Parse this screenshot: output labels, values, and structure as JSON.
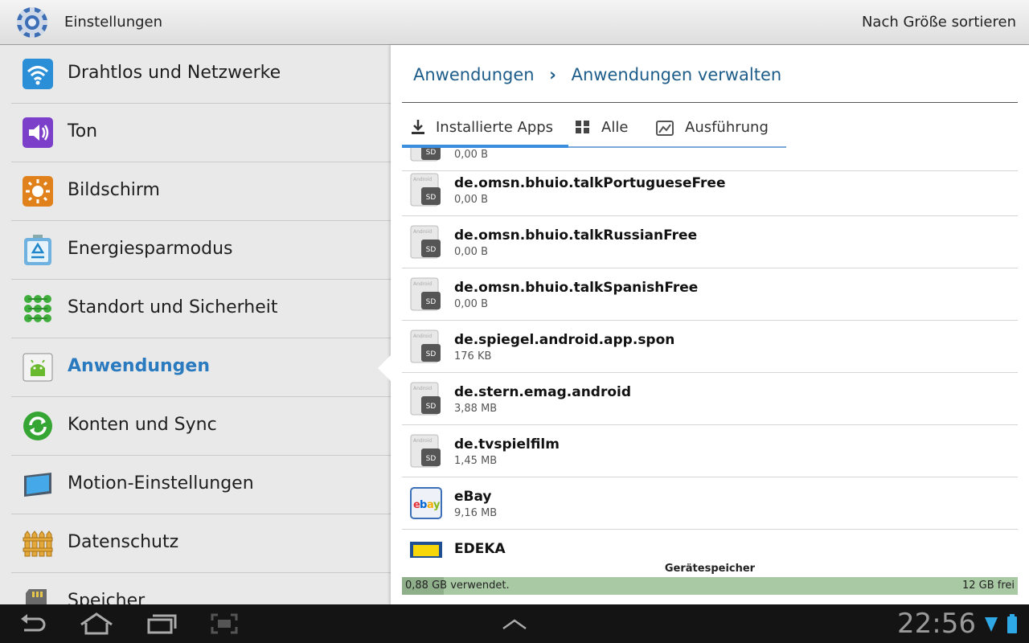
{
  "actionbar": {
    "title": "Einstellungen",
    "sort_label": "Nach Größe sortieren"
  },
  "sidebar": {
    "items": [
      {
        "label": "Drahtlos und Netzwerke",
        "icon": "wifi-icon"
      },
      {
        "label": "Ton",
        "icon": "speaker-icon"
      },
      {
        "label": "Bildschirm",
        "icon": "brightness-icon"
      },
      {
        "label": "Energiesparmodus",
        "icon": "recycle-icon"
      },
      {
        "label": "Standort und Sicherheit",
        "icon": "location-grid-icon"
      },
      {
        "label": "Anwendungen",
        "icon": "android-icon",
        "active": true
      },
      {
        "label": "Konten und Sync",
        "icon": "sync-icon"
      },
      {
        "label": "Motion-Einstellungen",
        "icon": "tablet-icon"
      },
      {
        "label": "Datenschutz",
        "icon": "fence-icon"
      },
      {
        "label": "Speicher",
        "icon": "sd-card-icon"
      }
    ]
  },
  "breadcrumb": {
    "parent": "Anwendungen",
    "separator": "›",
    "current": "Anwendungen verwalten"
  },
  "tabs": [
    {
      "label": "Installierte Apps",
      "icon": "download-icon",
      "active": true
    },
    {
      "label": "Alle",
      "icon": "grid-icon"
    },
    {
      "label": "Ausführung",
      "icon": "running-icon"
    }
  ],
  "apps": [
    {
      "name": "",
      "size": "0,00 B",
      "icon": "sd-app-icon"
    },
    {
      "name": "de.omsn.bhuio.talkPortugueseFree",
      "size": "0,00 B",
      "icon": "sd-app-icon"
    },
    {
      "name": "de.omsn.bhuio.talkRussianFree",
      "size": "0,00 B",
      "icon": "sd-app-icon"
    },
    {
      "name": "de.omsn.bhuio.talkSpanishFree",
      "size": "0,00 B",
      "icon": "sd-app-icon"
    },
    {
      "name": "de.spiegel.android.app.spon",
      "size": "176 KB",
      "icon": "sd-app-icon"
    },
    {
      "name": "de.stern.emag.android",
      "size": "3,88 MB",
      "icon": "sd-app-icon"
    },
    {
      "name": "de.tvspielfilm",
      "size": "1,45 MB",
      "icon": "sd-app-icon"
    },
    {
      "name": "eBay",
      "size": "9,16 MB",
      "icon": "ebay-icon"
    },
    {
      "name": "EDEKA",
      "size": "",
      "icon": "edeka-icon"
    }
  ],
  "storage": {
    "label": "Gerätespeicher",
    "used": "0,88 GB verwendet.",
    "free": "12 GB frei",
    "used_fraction": 0.068
  },
  "systembar": {
    "time": "22:56"
  },
  "colors": {
    "accent": "#2a7abf",
    "tab_indicator": "#3b8ddd",
    "storage": "#a9c9a4"
  }
}
